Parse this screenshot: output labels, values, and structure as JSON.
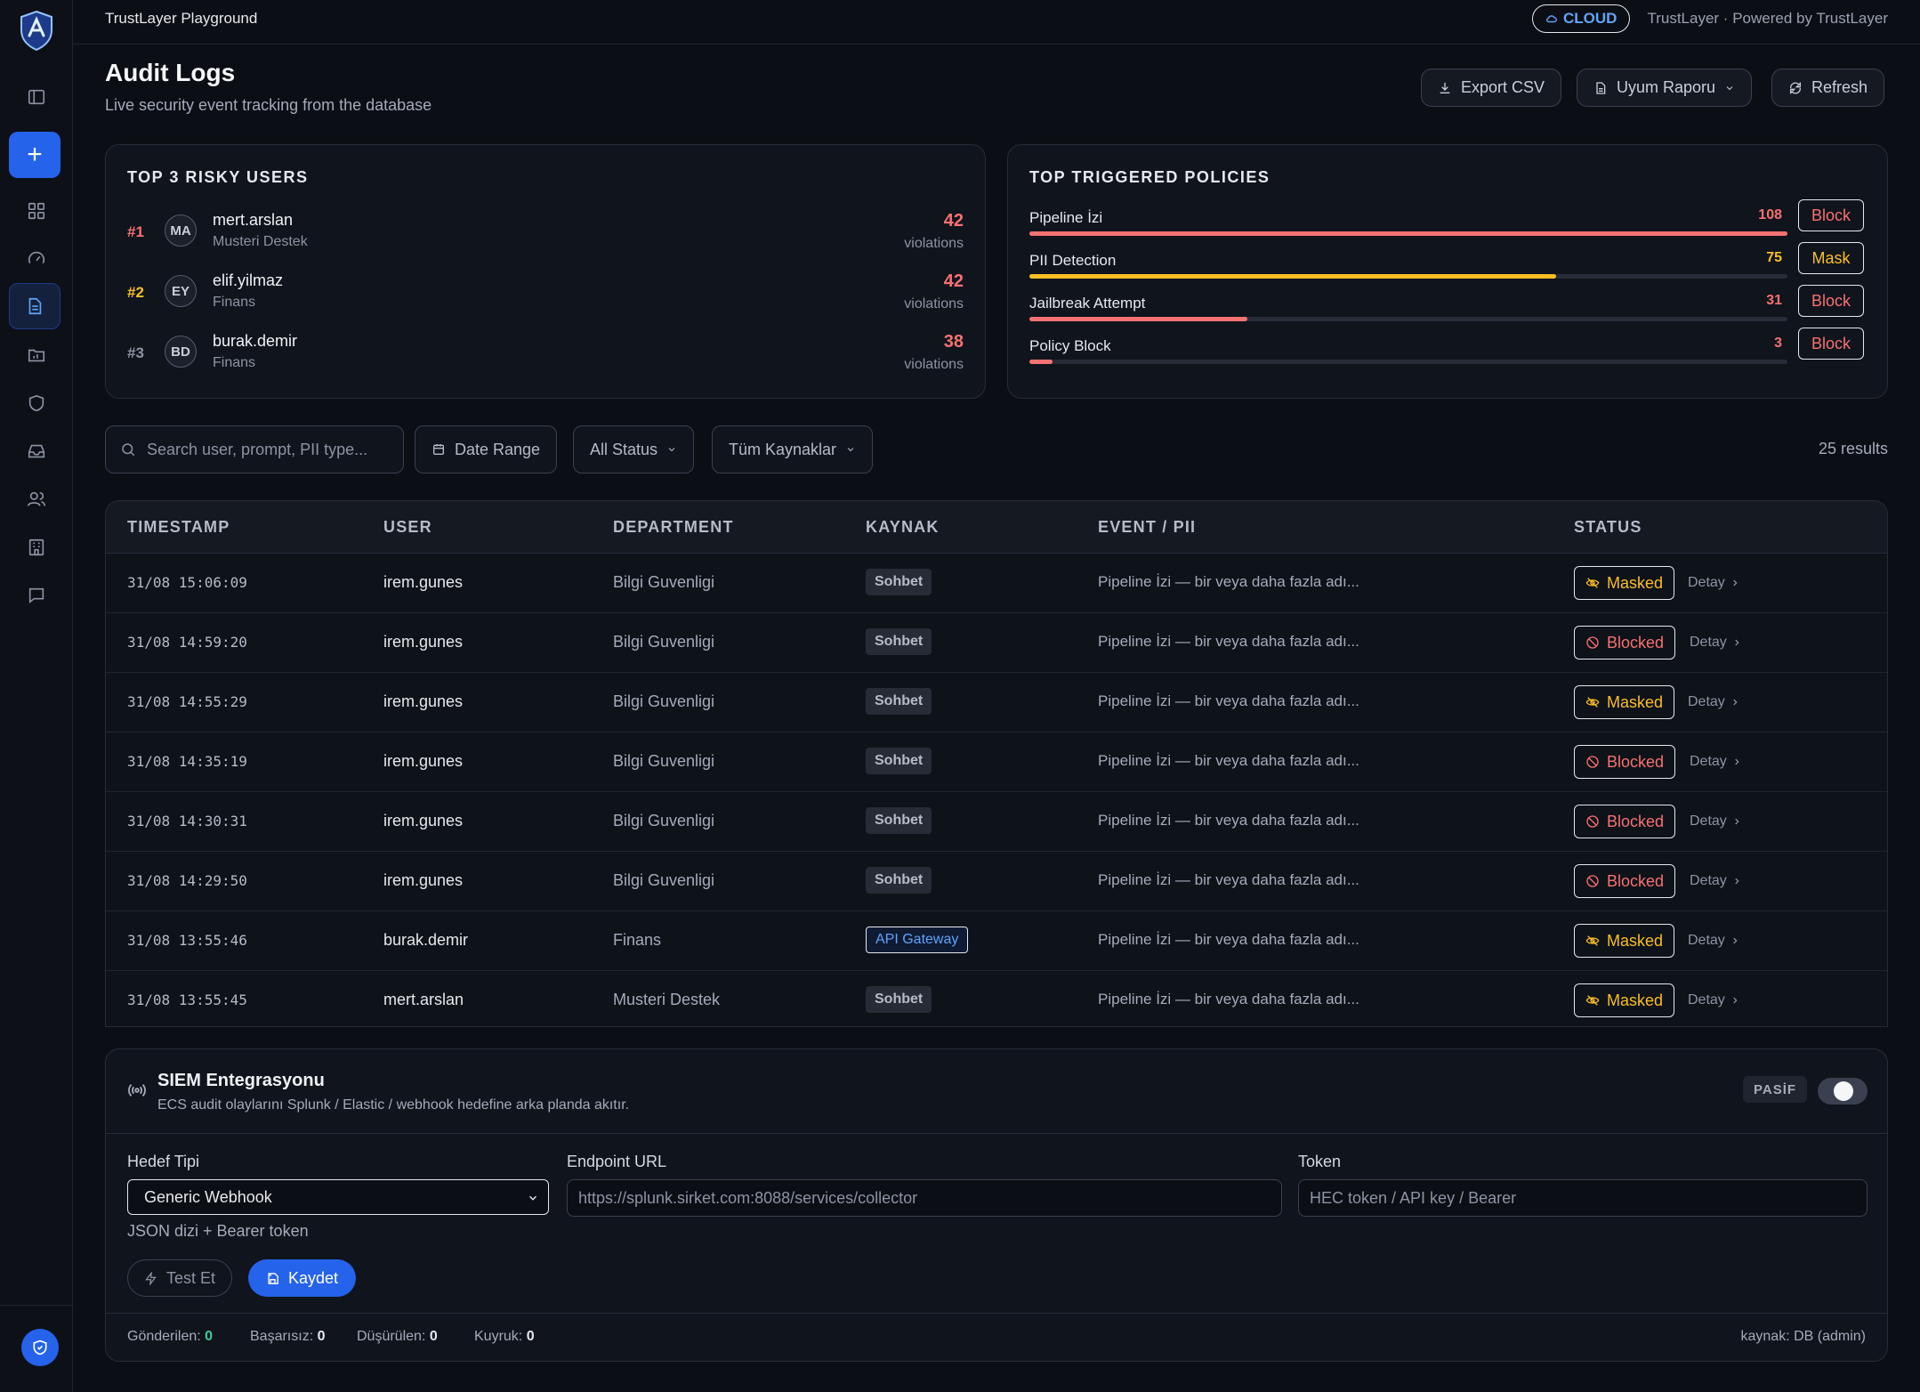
{
  "app": {
    "title": "TrustLayer Playground",
    "cloud_label": "CLOUD",
    "powered_by": "TrustLayer · Powered by TrustLayer"
  },
  "sidebar": {
    "new_label": "+"
  },
  "header": {
    "title": "Audit Logs",
    "subtitle": "Live security event tracking from the database",
    "export_label": "Export CSV",
    "report_label": "Uyum Raporu",
    "refresh_label": "Refresh"
  },
  "risky_users": {
    "title": "TOP 3 RISKY USERS",
    "items": [
      {
        "rank": "#1",
        "initials": "MA",
        "name": "mert.arslan",
        "dept": "Musteri Destek",
        "count": "42",
        "label": "violations"
      },
      {
        "rank": "#2",
        "initials": "EY",
        "name": "elif.yilmaz",
        "dept": "Finans",
        "count": "42",
        "label": "violations"
      },
      {
        "rank": "#3",
        "initials": "BD",
        "name": "burak.demir",
        "dept": "Finans",
        "count": "38",
        "label": "violations"
      }
    ]
  },
  "policies": {
    "title": "TOP TRIGGERED POLICIES",
    "max": 108,
    "items": [
      {
        "name": "Pipeline İzi",
        "count": "108",
        "value": 108,
        "action": "Block",
        "color": "#f87171",
        "action_color": "#f87171"
      },
      {
        "name": "PII Detection",
        "count": "75",
        "value": 75,
        "action": "Mask",
        "color": "#fbbf24",
        "action_color": "#fbbf24"
      },
      {
        "name": "Jailbreak Attempt",
        "count": "31",
        "value": 31,
        "action": "Block",
        "color": "#f87171",
        "action_color": "#f87171"
      },
      {
        "name": "Policy Block",
        "count": "3",
        "value": 3,
        "action": "Block",
        "color": "#f87171",
        "action_color": "#f87171"
      }
    ]
  },
  "filters": {
    "search_placeholder": "Search user, prompt, PII type...",
    "date_range": "Date Range",
    "status": "All Status",
    "sources": "Tüm Kaynaklar",
    "results": "25 results"
  },
  "table": {
    "headers": {
      "timestamp": "TIMESTAMP",
      "user": "USER",
      "department": "DEPARTMENT",
      "source": "KAYNAK",
      "event": "EVENT / PII",
      "status": "STATUS"
    },
    "detail_label": "Detay",
    "rows": [
      {
        "ts": "31/08 15:06:09",
        "user": "irem.gunes",
        "dept": "Bilgi Guvenligi",
        "source": "Sohbet",
        "source_type": "chat",
        "event": "Pipeline İzi — bir veya daha fazla adı...",
        "status": "Masked",
        "status_type": "masked"
      },
      {
        "ts": "31/08 14:59:20",
        "user": "irem.gunes",
        "dept": "Bilgi Guvenligi",
        "source": "Sohbet",
        "source_type": "chat",
        "event": "Pipeline İzi — bir veya daha fazla adı...",
        "status": "Blocked",
        "status_type": "blocked"
      },
      {
        "ts": "31/08 14:55:29",
        "user": "irem.gunes",
        "dept": "Bilgi Guvenligi",
        "source": "Sohbet",
        "source_type": "chat",
        "event": "Pipeline İzi — bir veya daha fazla adı...",
        "status": "Masked",
        "status_type": "masked"
      },
      {
        "ts": "31/08 14:35:19",
        "user": "irem.gunes",
        "dept": "Bilgi Guvenligi",
        "source": "Sohbet",
        "source_type": "chat",
        "event": "Pipeline İzi — bir veya daha fazla adı...",
        "status": "Blocked",
        "status_type": "blocked"
      },
      {
        "ts": "31/08 14:30:31",
        "user": "irem.gunes",
        "dept": "Bilgi Guvenligi",
        "source": "Sohbet",
        "source_type": "chat",
        "event": "Pipeline İzi — bir veya daha fazla adı...",
        "status": "Blocked",
        "status_type": "blocked"
      },
      {
        "ts": "31/08 14:29:50",
        "user": "irem.gunes",
        "dept": "Bilgi Guvenligi",
        "source": "Sohbet",
        "source_type": "chat",
        "event": "Pipeline İzi — bir veya daha fazla adı...",
        "status": "Blocked",
        "status_type": "blocked"
      },
      {
        "ts": "31/08 13:55:46",
        "user": "burak.demir",
        "dept": "Finans",
        "source": "API Gateway",
        "source_type": "api",
        "event": "Pipeline İzi — bir veya daha fazla adı...",
        "status": "Masked",
        "status_type": "masked"
      },
      {
        "ts": "31/08 13:55:45",
        "user": "mert.arslan",
        "dept": "Musteri Destek",
        "source": "Sohbet",
        "source_type": "chat",
        "event": "Pipeline İzi — bir veya daha fazla adı...",
        "status": "Masked",
        "status_type": "masked"
      }
    ]
  },
  "siem": {
    "title": "SIEM Entegrasyonu",
    "subtitle": "ECS audit olaylarını Splunk / Elastic / webhook hedefine arka planda akıtır.",
    "state": "PASİF",
    "target_label": "Hedef Tipi",
    "target_value": "Generic Webhook",
    "target_hint": "JSON dizi + Bearer token",
    "endpoint_label": "Endpoint URL",
    "endpoint_placeholder": "https://splunk.sirket.com:8088/services/collector",
    "token_label": "Token",
    "token_placeholder": "HEC token / API key / Bearer",
    "test_label": "Test Et",
    "save_label": "Kaydet",
    "stats": [
      {
        "label": "Gönderilen:",
        "value": "0"
      },
      {
        "label": "Başarısız:",
        "value": "0"
      },
      {
        "label": "Düşürülen:",
        "value": "0"
      },
      {
        "label": "Kuyruk:",
        "value": "0"
      }
    ],
    "source_note": "kaynak: DB (admin)"
  },
  "colors": {
    "accent": "#2563eb",
    "danger": "#f87171",
    "warning": "#fbbf24",
    "success": "#34d399"
  }
}
